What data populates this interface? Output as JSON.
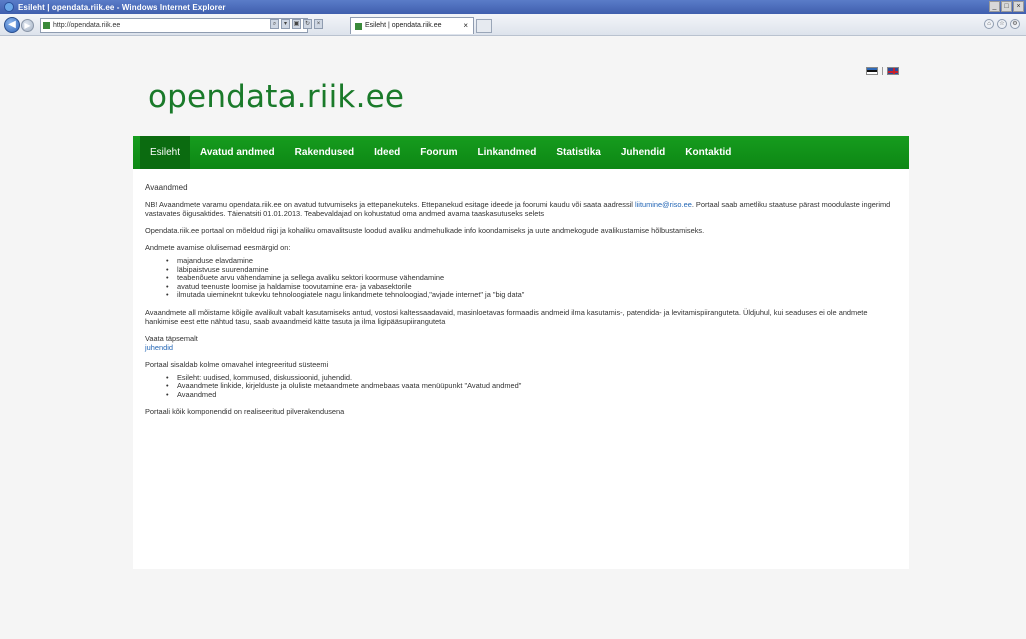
{
  "browser": {
    "window_title": "Esileht | opendata.riik.ee - Windows Internet Explorer",
    "address": "http://opendata.riik.ee",
    "tab_title": "Esileht | opendata.riik.ee"
  },
  "site": {
    "logo": "opendata.riik.ee",
    "languages": [
      "ee",
      "en"
    ]
  },
  "menu": [
    "Esileht",
    "Avatud andmed",
    "Rakendused",
    "Ideed",
    "Foorum",
    "Linkandmed",
    "Statistika",
    "Juhendid",
    "Kontaktid"
  ],
  "content": {
    "title": "Avaandmed",
    "p1_pre": "NB! Avaandmete varamu opendata.riik.ee on avatud tutvumiseks ja ettepanekuteks. Ettepanekud esitage ideede ja foorumi kaudu või saata aadressil ",
    "p1_link": "liitumine@riso.ee",
    "p1_post": ". Portaal saab ametliku staatuse pärast moodulaste ingerimd vastavates õigusaktides. Täienatsiti 01.01.2013. Teabevaldajad on kohustatud oma andmed avama taaskasutuseks selets",
    "p2": "Opendata.riik.ee portaal on mõeldud riigi ja kohaliku omavalitsuste loodud avaliku andmehulkade info koondamiseks ja uute andmekogude avalikustamise hõlbustamiseks.",
    "p3": "Andmete avamise olulisemad eesmärgid on:",
    "goals": [
      "majanduse elavdamine",
      "läbipaistvuse suurendamine",
      "teabenõuete arvu vähendamine ja sellega avaliku sektori koormuse vähendamine",
      "avatud teenuste loomise ja haldamise toovutamine era- ja vabasektorile",
      "ilmutada uiemineknt tukevku tehnoloogiatele nagu linkandmete tehnoloogiad,\"avjade internet\" ja \"big data\""
    ],
    "p4": "Avaandmete all mõistame kõigile avalikult vabalt kasutamiseks antud, vostosi kaltessaadavaid, masinloetavas formaadis andmeid ilma kasutamis-, patendida- ja levitamispiiranguteta. Üldjuhul, kui seaduses ei ole andmete hankimise eest ette nähtud tasu, saab avaandmeid kätte tasuta ja ilma ligipääsupiiranguteta",
    "see_label": "Vaata täpsemalt",
    "see_link": "juhendid",
    "p5": "Portaal sisaldab kolme omavahel integreeritud süsteemi",
    "systems": [
      "Esileht: uudised, kommused, diskussioonid, juhendid.",
      "Avaandmete linkide, kirjelduste ja oluliste metaandmete andmebaas vaata menüüpunkt \"Avatud andmed\"",
      "Avaandmed"
    ],
    "p6": "Portaali kõik komponendid on realiseeritud pilverakendusena"
  }
}
